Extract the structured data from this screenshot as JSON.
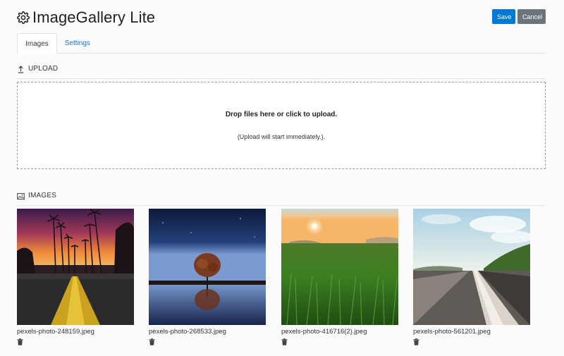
{
  "app": {
    "title": "ImageGallery Lite",
    "icon": "gear-icon"
  },
  "toolbar": {
    "save_label": "Save",
    "cancel_label": "Cancel",
    "colors": {
      "primary": "#0078d4",
      "secondary": "#6c757d"
    }
  },
  "tabs": [
    {
      "label": "Images",
      "active": true
    },
    {
      "label": "Settings",
      "active": false
    }
  ],
  "upload": {
    "section_label": "UPLOAD",
    "icon": "upload-icon",
    "drop_text": "Drop files here or click to upload.",
    "note": "(Upload will start immediately.)."
  },
  "images": {
    "section_label": "IMAGES",
    "icon": "image-icon",
    "items": [
      {
        "filename": "pexels-photo-248159.jpeg",
        "scene": "palm trees at sunset road"
      },
      {
        "filename": "pexels-photo-268533.jpeg",
        "scene": "lone tree reflected in water"
      },
      {
        "filename": "pexels-photo-416716(2).jpeg",
        "scene": "green grass field at sunrise"
      },
      {
        "filename": "pexels-photo-561201.jpeg",
        "scene": "road surface toward horizon"
      }
    ],
    "delete_icon": "trash-icon"
  }
}
